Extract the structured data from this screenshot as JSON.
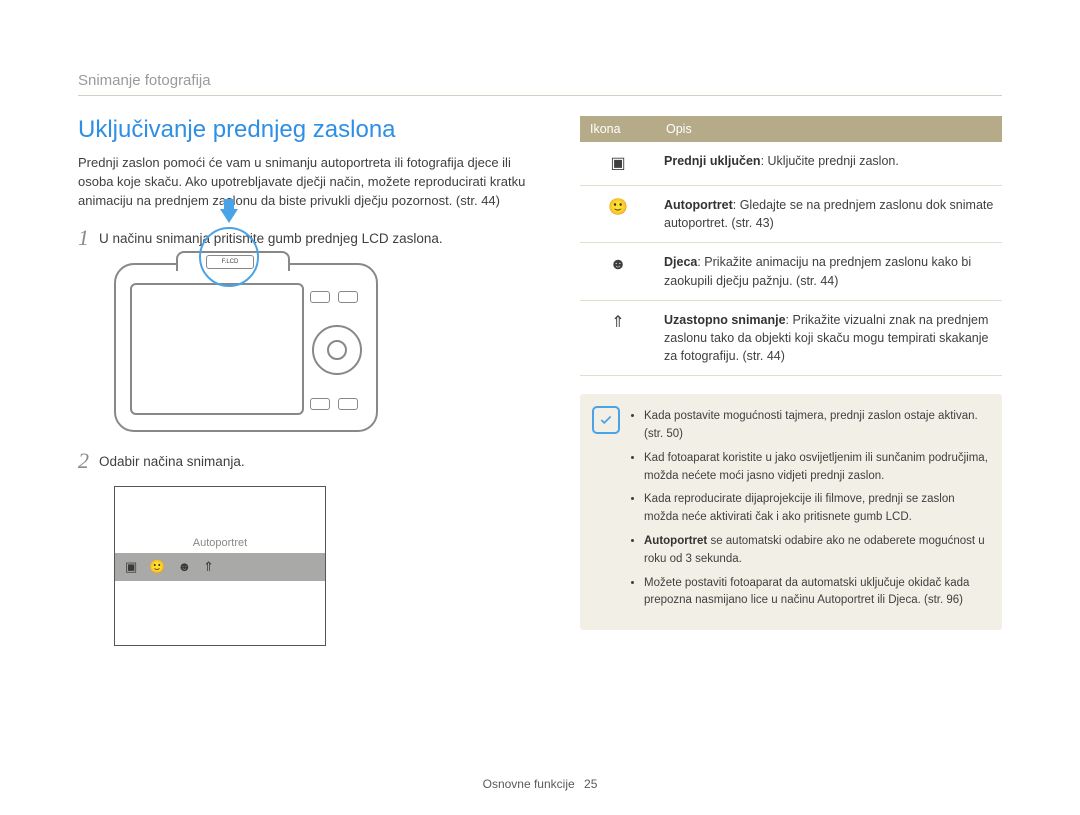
{
  "breadcrumb": "Snimanje fotografija",
  "title": "Uključivanje prednjeg zaslona",
  "intro": "Prednji zaslon pomoći će vam u snimanju autoportreta ili fotografija djece ili osoba koje skaču. Ako upotrebljavate dječji način, možete reproducirati kratku animaciju na prednjem zaslonu da biste privukli dječju pozornost. (str. 44)",
  "steps": [
    {
      "num": "1",
      "text": "U načinu snimanja pritisnite gumb prednjeg LCD zaslona."
    },
    {
      "num": "2",
      "text": "Odabir načina snimanja."
    }
  ],
  "camera_button_label": "F.LCD",
  "lcd_mode_label": "Autoportret",
  "table": {
    "headers": [
      "Ikona",
      "Opis"
    ],
    "rows": [
      {
        "icon": "front-on-icon",
        "bold": "Prednji uključen",
        "text": ": Uključite prednji zaslon."
      },
      {
        "icon": "selfportrait-icon",
        "bold": "Autoportret",
        "text": ": Gledajte se na prednjem zaslonu dok snimate autoportret. (str. 43)"
      },
      {
        "icon": "children-icon",
        "bold": "Djeca",
        "text": ": Prikažite animaciju na prednjem zaslonu kako bi zaokupili dječju pažnju. (str. 44)"
      },
      {
        "icon": "jump-icon",
        "bold": "Uzastopno snimanje",
        "text": ": Prikažite vizualni znak na prednjem zaslonu tako da objekti koji skaču mogu tempirati skakanje za fotografiju. (str. 44)"
      }
    ]
  },
  "notes": [
    "Kada postavite mogućnosti tajmera, prednji zaslon ostaje aktivan. (str. 50)",
    "Kad fotoaparat koristite u jako osvijetljenim ili sunčanim područjima, možda nećete moći jasno vidjeti prednji zaslon.",
    "Kada reproducirate dijaprojekcije ili filmove, prednji se zaslon možda neće aktivirati čak i ako pritisnete gumb LCD.",
    "<b>Autoportret</b> se automatski odabire ako ne odaberete mogućnost u roku od 3 sekunda.",
    "Možete postaviti fotoaparat da automatski uključuje okidač kada prepozna nasmijano lice u načinu Autoportret ili Djeca. (str. 96)"
  ],
  "footer": {
    "section": "Osnovne funkcije",
    "page": "25"
  }
}
